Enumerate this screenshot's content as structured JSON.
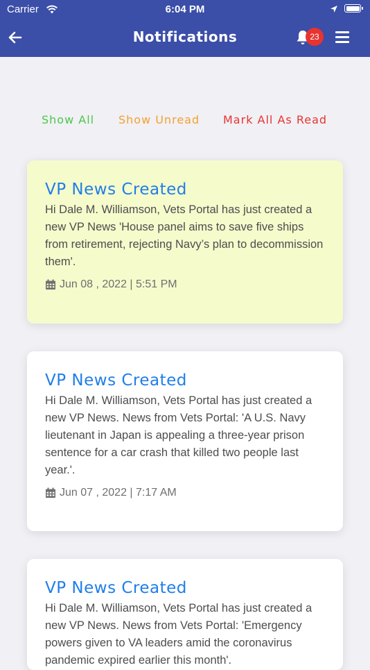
{
  "status_bar": {
    "carrier": "Carrier",
    "time": "6:04 PM"
  },
  "header": {
    "title": "Notifications",
    "badge_count": "23",
    "color": "#3b4ea8"
  },
  "filters": {
    "show_all": "Show All",
    "show_unread": "Show Unread",
    "mark_all_read": "Mark All As Read",
    "colors": {
      "show_all": "#4cc74a",
      "show_unread": "#f5a02c",
      "mark_all_read": "#e8342f"
    }
  },
  "notifications": [
    {
      "title": "VP News Created",
      "body": "Hi Dale M. Williamson, Vets Portal has just created a new VP News 'House panel aims to save five ships from retirement, rejecting Navy’s plan to decommission them'.",
      "date": "Jun 08 , 2022 | 5:51 PM",
      "unread": true
    },
    {
      "title": "VP News Created",
      "body": "Hi Dale M. Williamson, Vets Portal has just created a new VP News. News from Vets Portal: 'A U.S. Navy lieutenant in Japan is appealing a three-year prison sentence for a car crash that killed two people last year.'.",
      "date": "Jun 07 , 2022 | 7:17 AM",
      "unread": false
    },
    {
      "title": "VP News Created",
      "body": "Hi Dale M. Williamson, Vets Portal has just created a new VP News. News from Vets Portal: 'Emergency powers given to VA leaders amid the coronavirus pandemic expired earlier this month'.",
      "date": "",
      "unread": false
    }
  ],
  "colors": {
    "unread_card_bg": "#f6fbcc",
    "read_card_bg": "#ffffff",
    "title_blue": "#1f7ee8"
  }
}
